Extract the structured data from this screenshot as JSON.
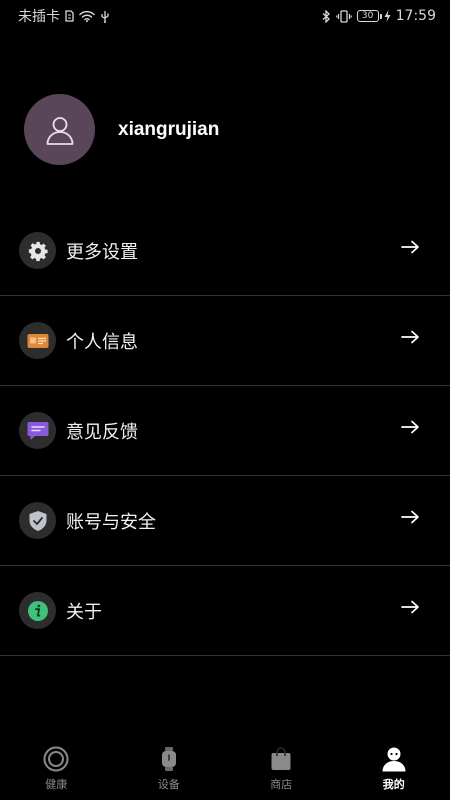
{
  "status_bar": {
    "carrier": "未插卡",
    "battery": "30",
    "time": "17:59"
  },
  "profile": {
    "username": "xiangrujian"
  },
  "menu": {
    "items": [
      {
        "label": "更多设置",
        "icon": "gear-icon"
      },
      {
        "label": "个人信息",
        "icon": "id-card-icon"
      },
      {
        "label": "意见反馈",
        "icon": "feedback-icon"
      },
      {
        "label": "账号与安全",
        "icon": "shield-icon"
      },
      {
        "label": "关于",
        "icon": "info-icon"
      }
    ]
  },
  "bottom_nav": {
    "items": [
      {
        "label": "健康",
        "icon": "health-ring-icon"
      },
      {
        "label": "设备",
        "icon": "watch-icon"
      },
      {
        "label": "商店",
        "icon": "shopping-bag-icon"
      },
      {
        "label": "我的",
        "icon": "profile-icon"
      }
    ],
    "active": "我的"
  },
  "colors": {
    "background": "#000000",
    "avatar_bg": "#5a4659",
    "icon_circle_bg": "#2d2d2d",
    "card_orange": "#e0873a",
    "feedback_purple": "#8a5bd8",
    "info_green": "#3ec27a",
    "divider": "#333333"
  }
}
